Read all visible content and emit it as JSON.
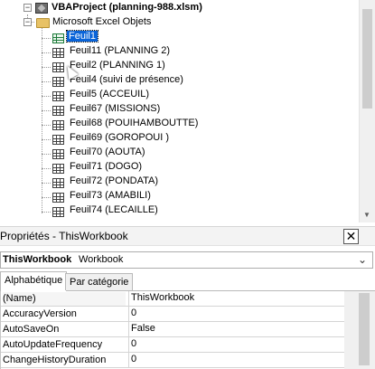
{
  "tree": {
    "project": {
      "label": "VBAProject (planning-988.xlsm)",
      "icon": "project-icon"
    },
    "folder": {
      "label": "Microsoft Excel Objets",
      "icon": "folder-icon"
    },
    "sheets": [
      {
        "label": "Feuil1",
        "selected": true
      },
      {
        "label": "Feuil11 (PLANNING 2)"
      },
      {
        "label": "Feuil2 (PLANNING 1)"
      },
      {
        "label": "Feuil4 (suivi de présence)"
      },
      {
        "label": "Feuil5 (ACCEUIL)"
      },
      {
        "label": "Feuil67 (MISSIONS)"
      },
      {
        "label": "Feuil68 (POUIHAMBOUTTE)"
      },
      {
        "label": "Feuil69 (GOROPOUI )"
      },
      {
        "label": "Feuil70 (AOUTA)"
      },
      {
        "label": "Feuil71 (DOGO)"
      },
      {
        "label": "Feuil72 (PONDATA)"
      },
      {
        "label": "Feuil73 (AMABILI)"
      },
      {
        "label": "Feuil74 (LECAILLE)"
      }
    ]
  },
  "properties": {
    "title": "Propriétés - ThisWorkbook",
    "close_symbol": "✕",
    "object_name": "ThisWorkbook",
    "object_type": "Workbook",
    "tabs": [
      {
        "label": "Alphabétique",
        "active": true
      },
      {
        "label": "Par catégorie",
        "active": false
      }
    ],
    "rows": [
      {
        "name": "(Name)",
        "value": "ThisWorkbook"
      },
      {
        "name": "AccuracyVersion",
        "value": "0"
      },
      {
        "name": "AutoSaveOn",
        "value": "False"
      },
      {
        "name": "AutoUpdateFrequency",
        "value": "0"
      },
      {
        "name": "ChangeHistoryDuration",
        "value": "0"
      }
    ]
  },
  "colors": {
    "selection": "#0a64d8",
    "folder": "#e8c266"
  }
}
